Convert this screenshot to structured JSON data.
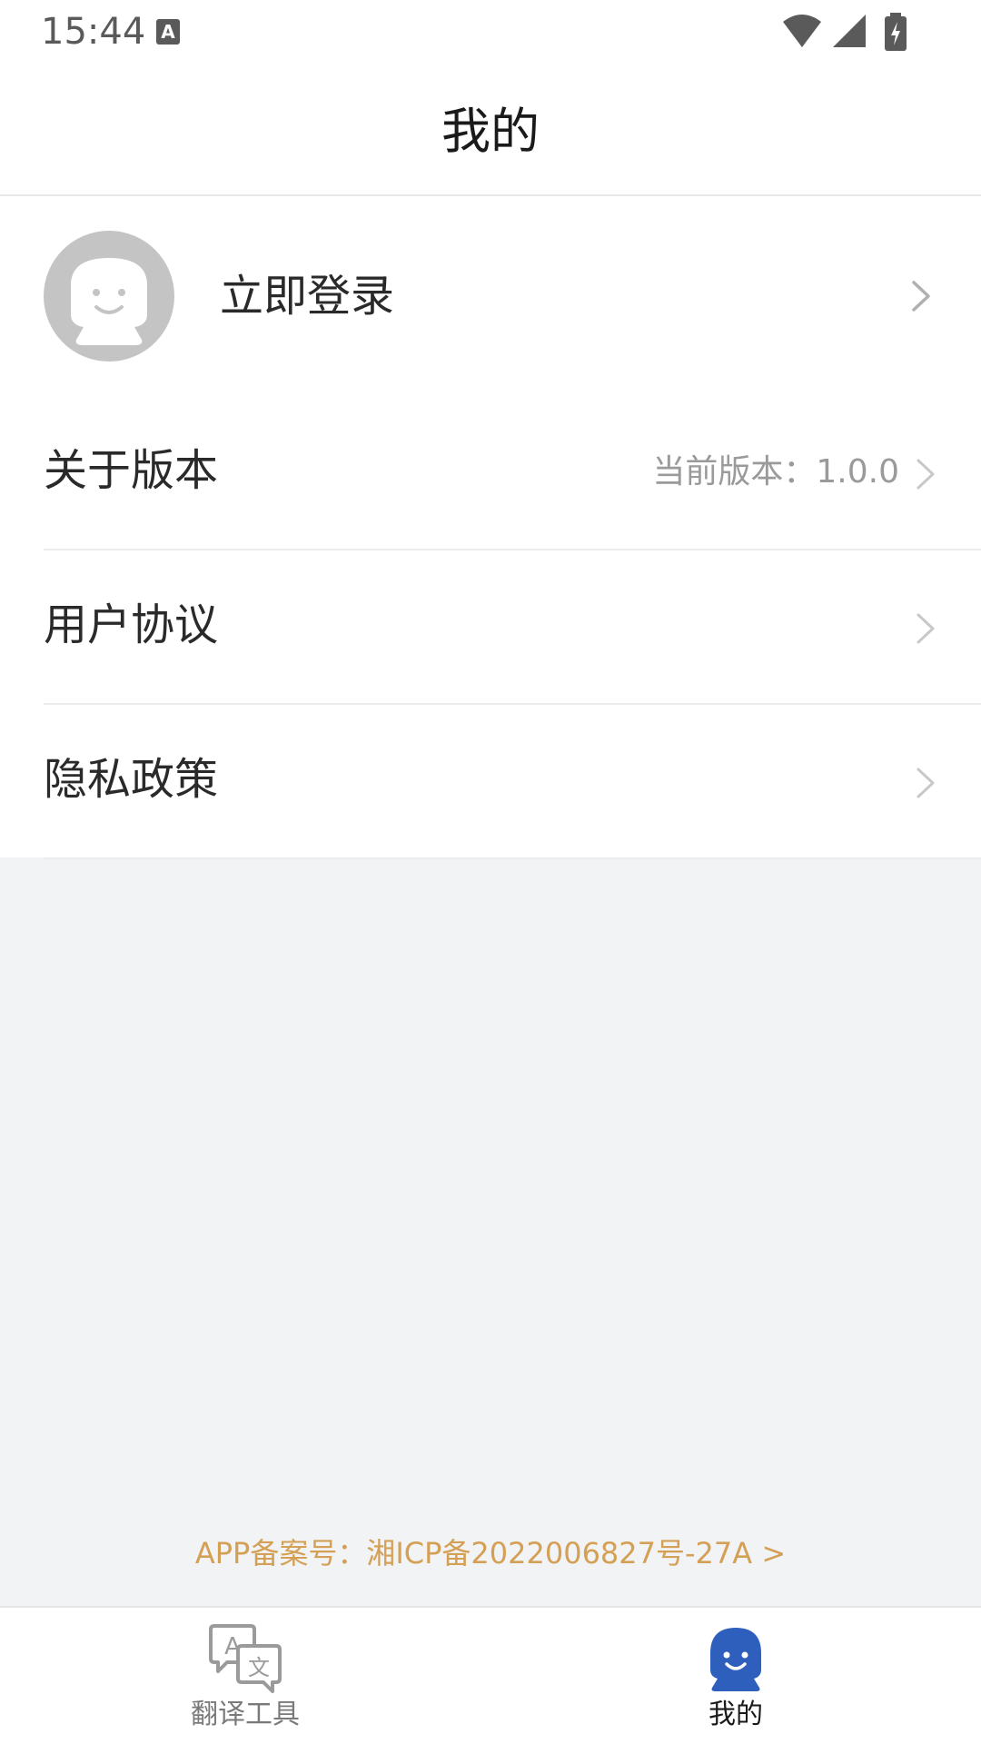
{
  "status_bar": {
    "time": "15:44",
    "notification_icon": "a-notification-icon",
    "wifi_icon": "wifi-icon",
    "signal_icon": "signal-icon",
    "battery_icon": "battery-charging-icon"
  },
  "header": {
    "title": "我的"
  },
  "profile": {
    "login_label": "立即登录",
    "avatar_icon": "avatar-placeholder-icon"
  },
  "menu": {
    "items": [
      {
        "label": "关于版本",
        "value": "当前版本：1.0.0"
      },
      {
        "label": "用户协议",
        "value": ""
      },
      {
        "label": "隐私政策",
        "value": ""
      }
    ]
  },
  "footer": {
    "icp_link": "APP备案号：湘ICP备2022006827号-27A >"
  },
  "tabbar": {
    "tabs": [
      {
        "label": "翻译工具",
        "icon": "translate-icon",
        "active": false
      },
      {
        "label": "我的",
        "icon": "profile-icon",
        "active": true
      }
    ]
  },
  "colors": {
    "page_background": "#f2f3f5",
    "surface": "#ffffff",
    "footer_link": "#d4a055",
    "active_tab_icon": "#2f5fbd",
    "inactive_tab": "#7a7a7a",
    "avatar_bg": "#c4c4c4"
  }
}
